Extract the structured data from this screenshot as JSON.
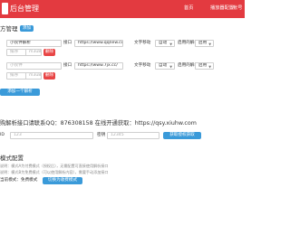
{
  "header": {
    "title": "后台管理",
    "nav": [
      {
        "label": "首页"
      },
      {
        "label": "播放器配置"
      },
      {
        "label": "帐号"
      }
    ]
  },
  "api_section": {
    "title": "方管理",
    "add_button": "添加",
    "rows": [
      {
        "name_value": "小伙伴解析",
        "name_placeholder": "",
        "sort_value": "",
        "sort_placeholder": "排序",
        "type_value": "",
        "type_placeholder": "m3u8",
        "url_label": "接口",
        "url_value": "https://www.qqnew.cc/",
        "mobile_label": "文字移动",
        "mobile_value": "自动",
        "enable_label": "启用的解析",
        "enable_value": "启用",
        "delete_button": "删除"
      },
      {
        "name_value": "",
        "name_placeholder": "小伙伴",
        "sort_value": "",
        "sort_placeholder": "排序",
        "type_value": "",
        "type_placeholder": "m3u8",
        "url_label": "接口",
        "url_value": "https://www.7jx.cc/",
        "mobile_label": "文字移动",
        "mobile_value": "自动",
        "enable_label": "启用的解析",
        "enable_value": "启用",
        "delete_button": "删除"
      }
    ],
    "add_api_button": "添加一个解析"
  },
  "contact": {
    "line": "购解析接口请联系QQ：876308158 在线开通获取：https://qsy.xiuhw.com"
  },
  "auth": {
    "id_label": "ID",
    "id_placeholder": "123",
    "key_label": "密钥",
    "key_placeholder": "12345",
    "buy_button": "获取授权获取"
  },
  "mode_section": {
    "title": "模式配置",
    "desc_1": "说明：模式A为付费模式（授权后），无需配置可直接使用解析接口",
    "desc_2": "说明：模式B为免费模式（可以使用解析内容），需要手动添加接口",
    "current_label": "当前模式：免费模式",
    "switch_button": "切换为收费模式"
  },
  "colors": {
    "brand_red": "#e33a40",
    "primary_blue": "#3a9ad9",
    "danger_red": "#e84545"
  }
}
